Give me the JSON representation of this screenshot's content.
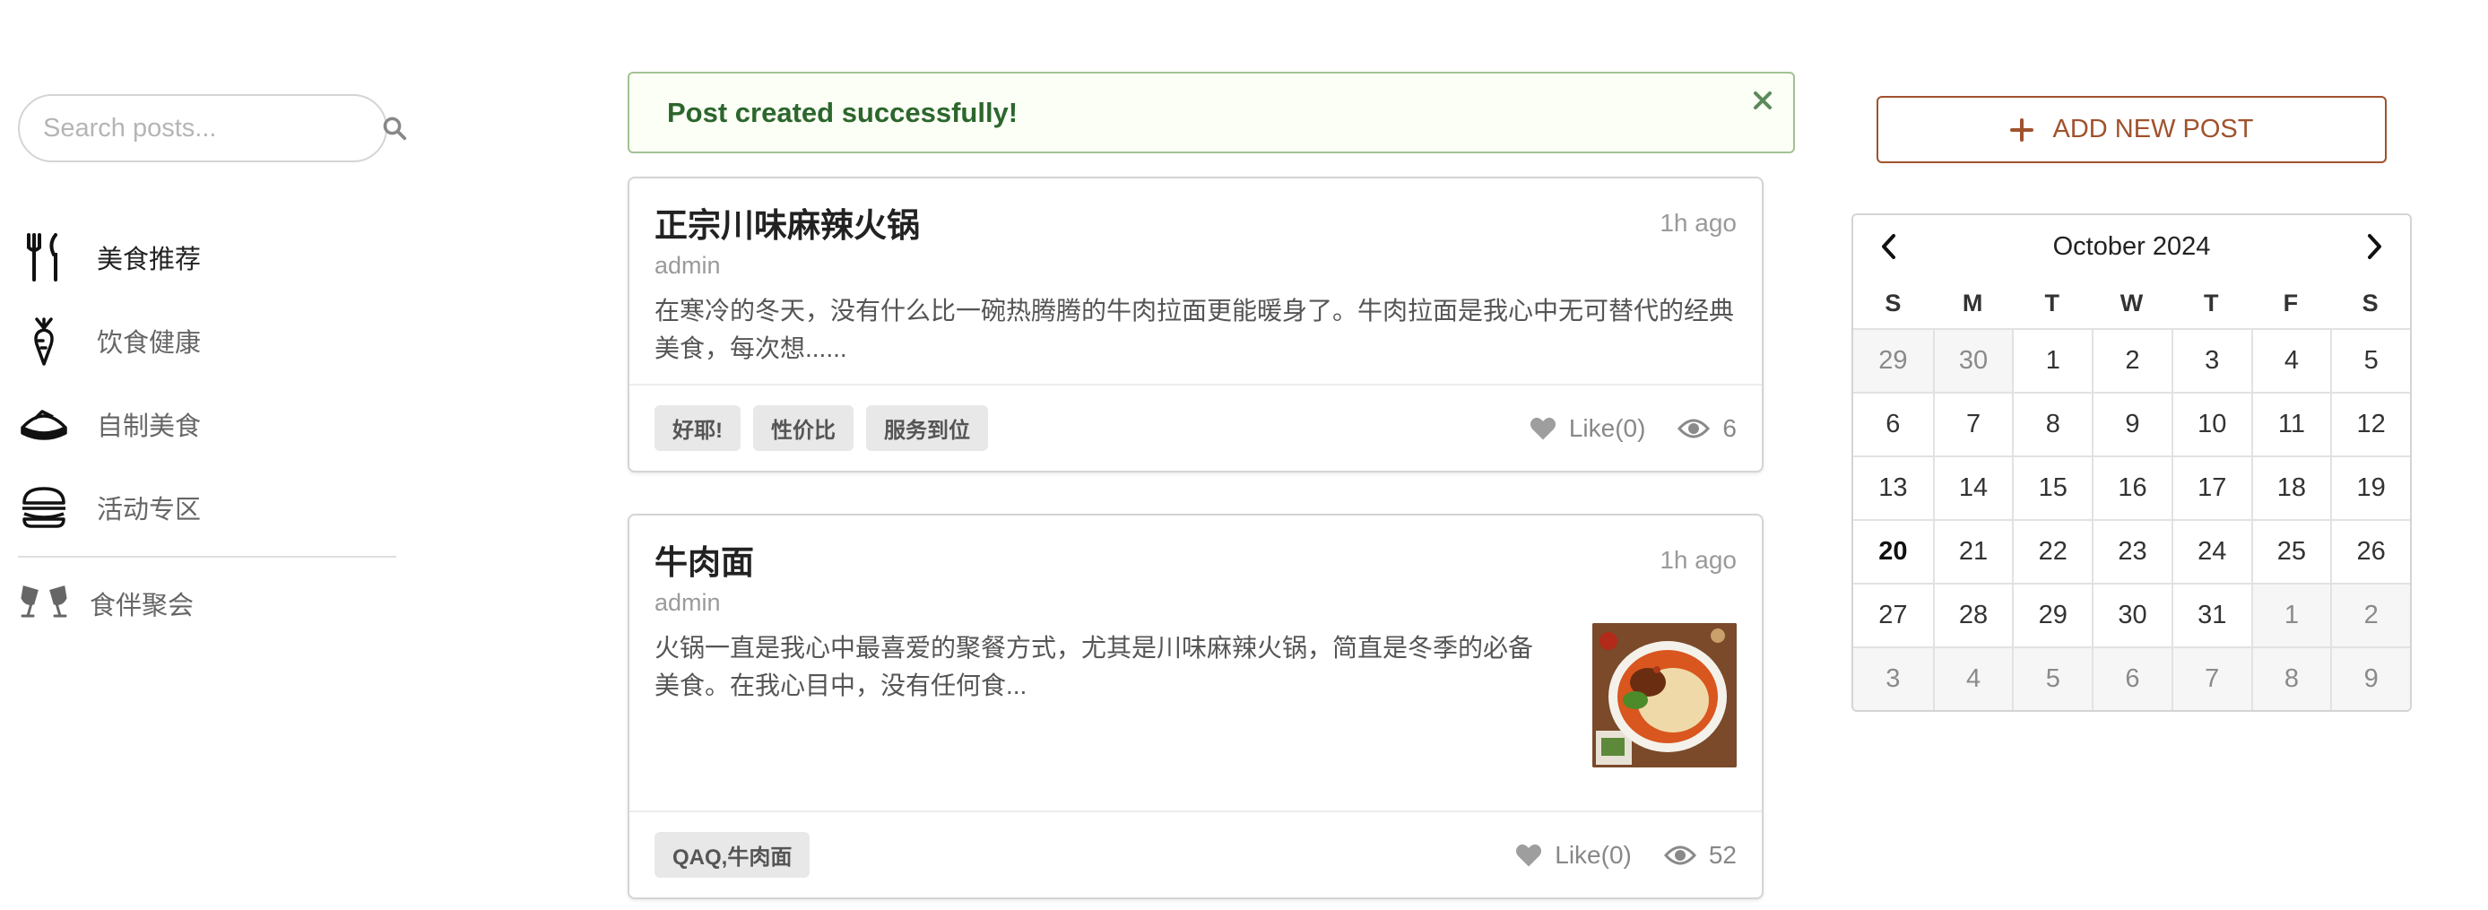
{
  "search": {
    "placeholder": "Search posts..."
  },
  "nav": {
    "items": [
      {
        "label": "美食推荐",
        "icon": "utensils-icon",
        "active": true
      },
      {
        "label": "饮食健康",
        "icon": "carrot-icon",
        "active": false
      },
      {
        "label": "自制美食",
        "icon": "cake-icon",
        "active": false
      },
      {
        "label": "活动专区",
        "icon": "burger-icon",
        "active": false
      }
    ],
    "secondary": {
      "label": "食伴聚会",
      "icon": "cheers-icon"
    }
  },
  "flash": {
    "message": "Post created successfully!"
  },
  "posts": [
    {
      "title": "正宗川味麻辣火锅",
      "time": "1h ago",
      "author": "admin",
      "excerpt": "在寒冷的冬天，没有什么比一碗热腾腾的牛肉拉面更能暖身了。牛肉拉面是我心中无可替代的经典美食，每次想......",
      "tags": [
        "好耶!",
        "性价比",
        "服务到位"
      ],
      "like_label": "Like(0)",
      "views": "6"
    },
    {
      "title": "牛肉面",
      "time": "1h ago",
      "author": "admin",
      "excerpt": "火锅一直是我心中最喜爱的聚餐方式，尤其是川味麻辣火锅，简直是冬季的必备美食。在我心目中，没有任何食...",
      "tags": [
        "QAQ,牛肉面"
      ],
      "like_label": "Like(0)",
      "views": "52",
      "thumbnail": "beef-noodle-bowl"
    }
  ],
  "add_button": {
    "label": "ADD NEW POST"
  },
  "calendar": {
    "month_label": "October 2024",
    "weekdays": [
      "S",
      "M",
      "T",
      "W",
      "T",
      "F",
      "S"
    ],
    "today": "20",
    "weeks": [
      [
        {
          "d": "29",
          "muted": true
        },
        {
          "d": "30",
          "muted": true
        },
        {
          "d": "1"
        },
        {
          "d": "2"
        },
        {
          "d": "3"
        },
        {
          "d": "4"
        },
        {
          "d": "5"
        }
      ],
      [
        {
          "d": "6"
        },
        {
          "d": "7"
        },
        {
          "d": "8"
        },
        {
          "d": "9"
        },
        {
          "d": "10"
        },
        {
          "d": "11"
        },
        {
          "d": "12"
        }
      ],
      [
        {
          "d": "13"
        },
        {
          "d": "14"
        },
        {
          "d": "15"
        },
        {
          "d": "16"
        },
        {
          "d": "17"
        },
        {
          "d": "18"
        },
        {
          "d": "19"
        }
      ],
      [
        {
          "d": "20",
          "today": true
        },
        {
          "d": "21"
        },
        {
          "d": "22"
        },
        {
          "d": "23"
        },
        {
          "d": "24"
        },
        {
          "d": "25"
        },
        {
          "d": "26"
        }
      ],
      [
        {
          "d": "27"
        },
        {
          "d": "28"
        },
        {
          "d": "29"
        },
        {
          "d": "30"
        },
        {
          "d": "31"
        },
        {
          "d": "1",
          "muted": true
        },
        {
          "d": "2",
          "muted": true
        }
      ],
      [
        {
          "d": "3",
          "muted": true
        },
        {
          "d": "4",
          "muted": true
        },
        {
          "d": "5",
          "muted": true
        },
        {
          "d": "6",
          "muted": true
        },
        {
          "d": "7",
          "muted": true
        },
        {
          "d": "8",
          "muted": true
        },
        {
          "d": "9",
          "muted": true
        }
      ]
    ]
  },
  "colors": {
    "accent": "#a0522d",
    "flash_border": "#a3c293",
    "flash_text": "#2c662d",
    "muted_text": "#9a9a9a"
  }
}
